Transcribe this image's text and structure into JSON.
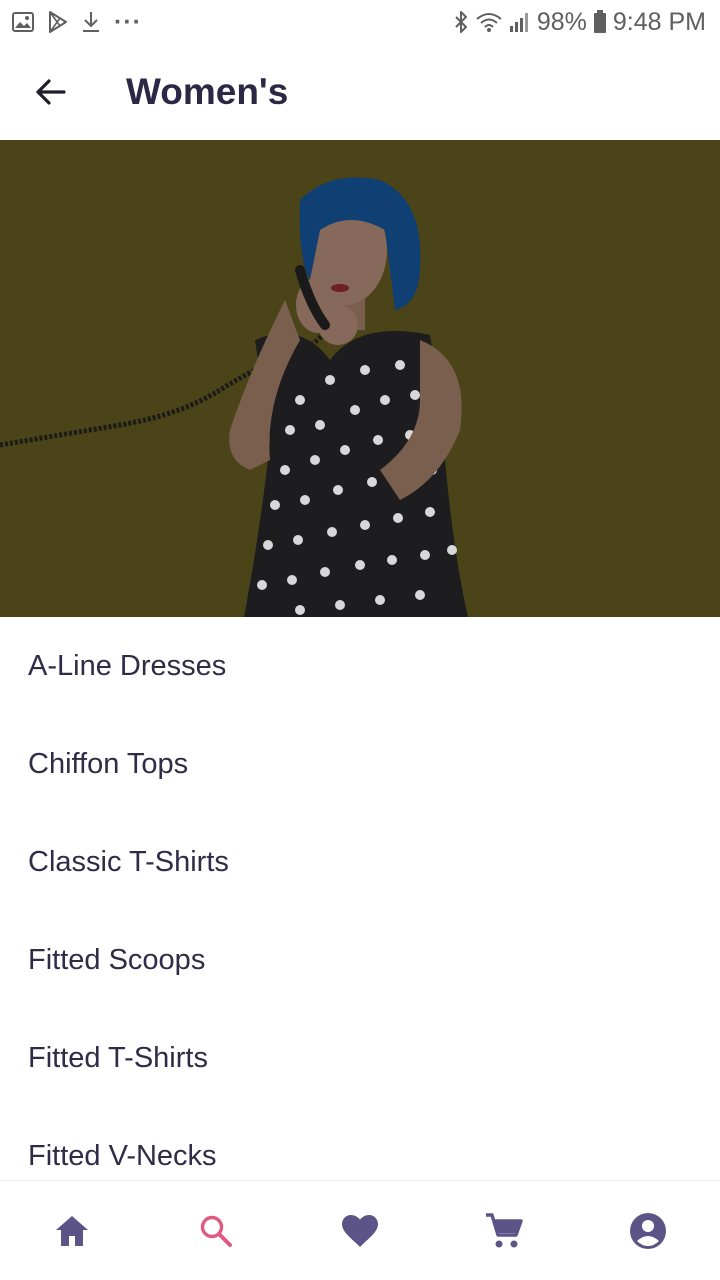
{
  "status_bar": {
    "battery": "98%",
    "time": "9:48 PM",
    "more": "···"
  },
  "app_bar": {
    "title": "Women's",
    "back_icon": "arrow-back-icon"
  },
  "colors": {
    "title": "#2b2744",
    "text": "#2f2c47",
    "nav_icon": "#5c5486",
    "nav_active": "#e0597e",
    "hero_bg": "#4a4418"
  },
  "categories": [
    {
      "label": "A-Line Dresses"
    },
    {
      "label": "Chiffon Tops"
    },
    {
      "label": "Classic T-Shirts"
    },
    {
      "label": "Fitted Scoops"
    },
    {
      "label": "Fitted T-Shirts"
    },
    {
      "label": "Fitted V-Necks"
    }
  ],
  "bottom_nav": [
    {
      "icon": "home-icon",
      "active": false
    },
    {
      "icon": "search-icon",
      "active": true
    },
    {
      "icon": "heart-icon",
      "active": false
    },
    {
      "icon": "cart-icon",
      "active": false
    },
    {
      "icon": "account-icon",
      "active": false
    }
  ]
}
